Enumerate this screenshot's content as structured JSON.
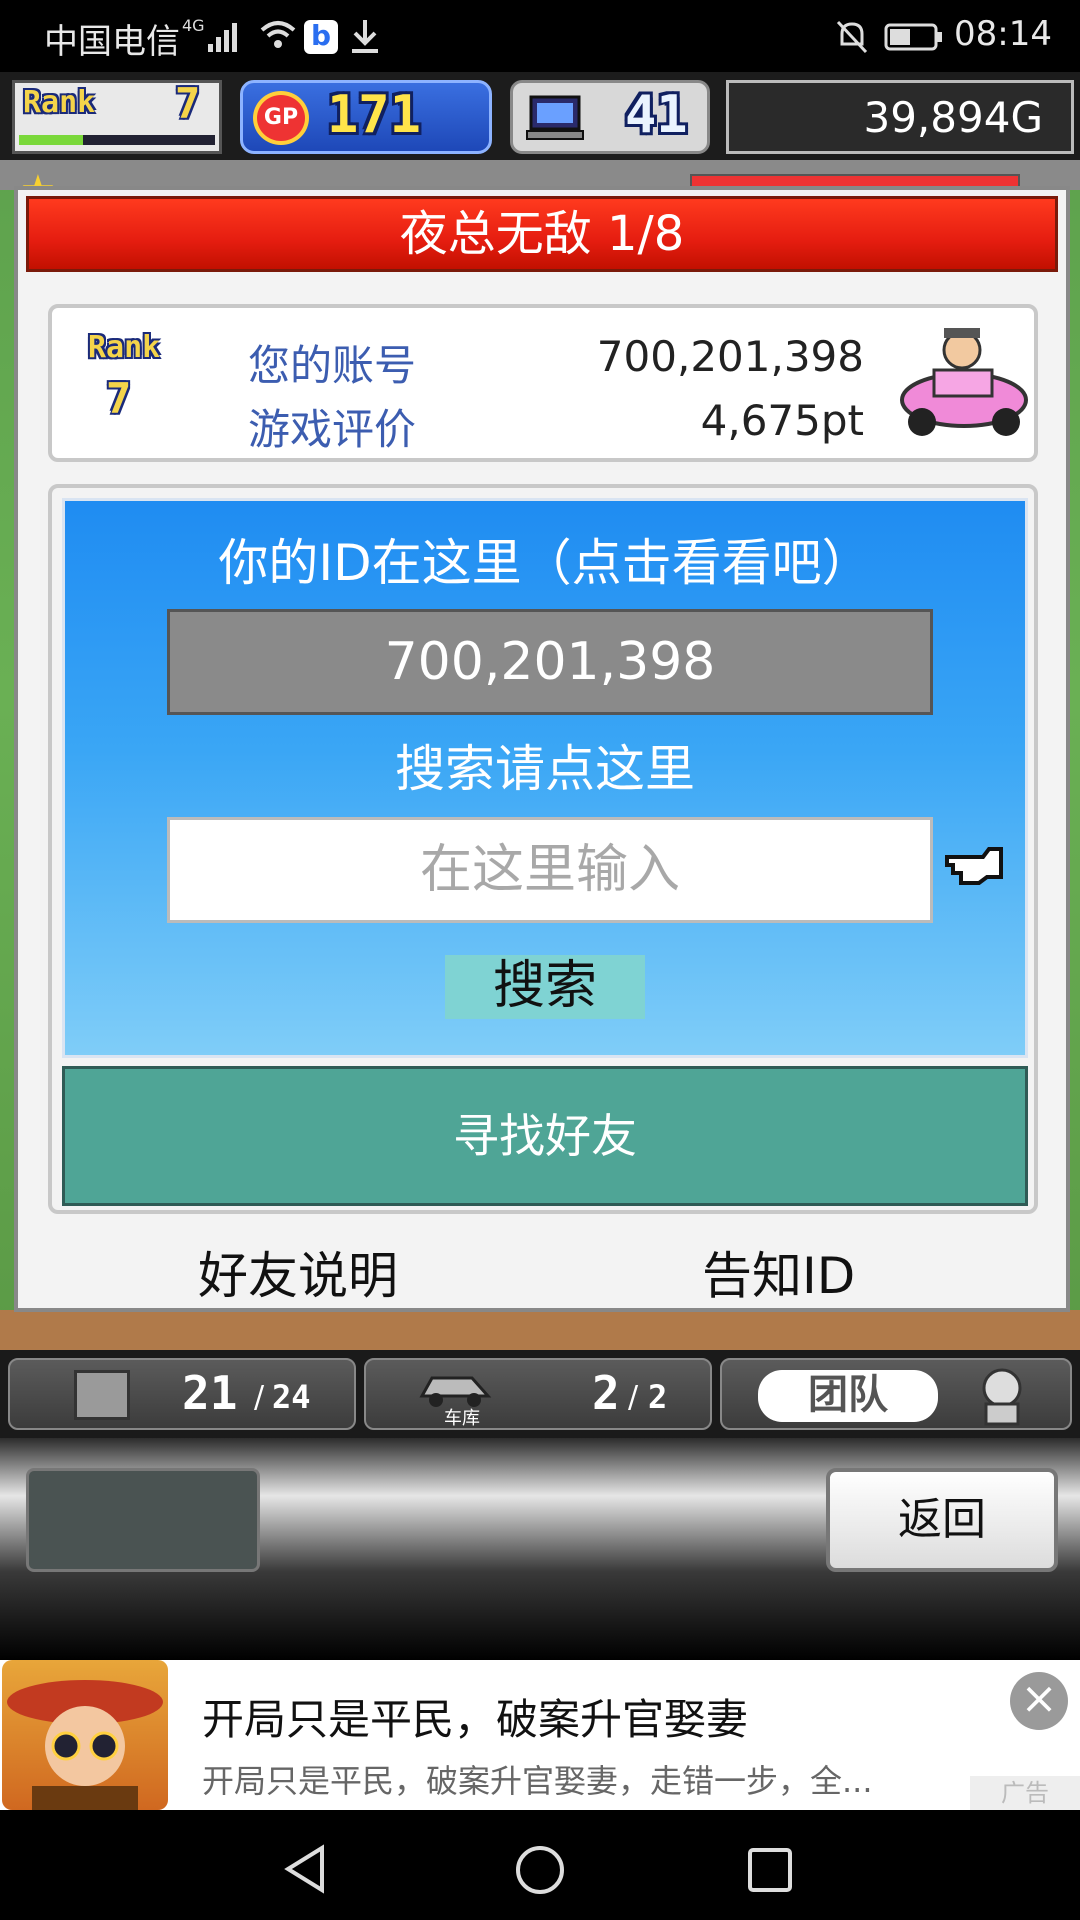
{
  "status_bar": {
    "carrier": "中国电信",
    "network": "4G",
    "time": "08:14"
  },
  "hud": {
    "rank_label": "Rank",
    "rank_value": "7",
    "gp_label": "GP",
    "gp_value": "171",
    "pc_value": "41",
    "money": "39,894G"
  },
  "dialog": {
    "title": "夜总无敌 1/8",
    "rank_label": "Rank",
    "rank_value": "7",
    "account_label": "您的账号",
    "account_value": "700,201,398",
    "rating_label": "游戏评价",
    "rating_value": "4,675pt",
    "id_prompt": "你的ID在这里（点击看看吧）",
    "id_value": "700,201,398",
    "search_prompt": "搜索请点这里",
    "search_placeholder": "在这里输入",
    "search_button": "搜索",
    "find_friends": "寻找好友",
    "friend_info": "好友说明",
    "tell_id": "告知ID"
  },
  "toolbar": {
    "slots_count": "21",
    "slots_total": "24",
    "garage_label": "车库",
    "garage_count": "2",
    "garage_total": "2",
    "team_label": "团队"
  },
  "bottom": {
    "back_button": "返回"
  },
  "ad": {
    "title": "开局只是平民，破案升官娶妻",
    "description": "开局只是平民，破案升官娶妻，走错一步，全...",
    "close": "×",
    "tag": "广告"
  },
  "colors": {
    "title_red": "#e51d10",
    "panel_blue": "#3aa6f5",
    "find_friends_teal": "#4fa596",
    "label_blue": "#3c5db0"
  }
}
